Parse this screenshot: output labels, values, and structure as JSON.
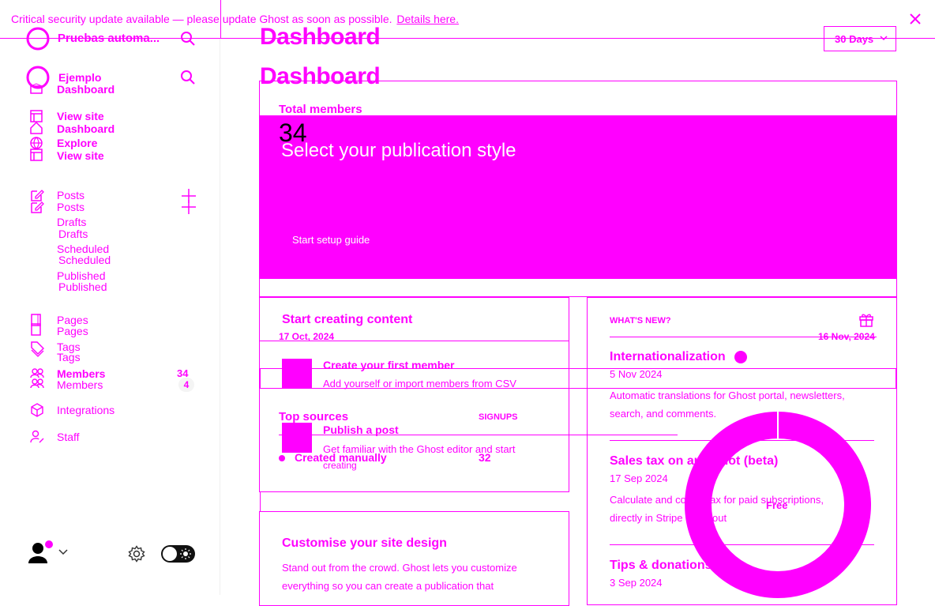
{
  "banner": {
    "message": "Critical security update available — please update Ghost as soon as possible.",
    "link": "Details here."
  },
  "site": {
    "name": "Pruebas automa...",
    "name_ghost": "Ejemplo"
  },
  "sidebar": {
    "dashboard": "Dashboard",
    "view_site": "View site",
    "dashboard_ghost": "Dashboard",
    "explore": "Explore",
    "view_site_ghost": "View site",
    "posts": "Posts",
    "posts_ghost": "Posts",
    "drafts": "Drafts",
    "drafts_ghost": "Drafts",
    "scheduled": "Scheduled",
    "scheduled_ghost": "Scheduled",
    "published": "Published",
    "published_ghost": "Published",
    "pages": "Pages",
    "pages_ghost": "Pages",
    "tags": "Tags",
    "tags_ghost": "Tags",
    "members": "Members",
    "members_count": "34",
    "members_ghost": "Members",
    "members_ghost_count": "4",
    "integrations": "Integrations",
    "staff": "Staff"
  },
  "header": {
    "title": "Dashboard",
    "title_ghost": "Dashboard",
    "range": "30 Days"
  },
  "members_card": {
    "label": "Total members",
    "value": "34"
  },
  "setup_banner": {
    "title": "Select your publication style",
    "button": "Start setup guide"
  },
  "start_creating": {
    "title": "Start creating content",
    "date": "17 Oct, 2024",
    "items": [
      {
        "title": "Create your first member",
        "desc": "Add yourself or import members from CSV"
      },
      {
        "title": "Publish a post",
        "desc": "Get familiar with the Ghost editor and start",
        "desc2": "creating"
      }
    ]
  },
  "top_sources": {
    "title": "Top sources",
    "col": "SIGNUPS",
    "rows": [
      {
        "source": "Created manually",
        "count": "32"
      }
    ]
  },
  "customise": {
    "title": "Customise your site design",
    "line1": "Stand out from the crowd. Ghost lets you customize",
    "line2": "everything so you can create a publication that"
  },
  "whats_new": {
    "label": "WHAT'S NEW?",
    "date": "16 Nov, 2024",
    "entries": [
      {
        "title": "Internationalization",
        "date": "5 Nov 2024",
        "line1": "Automatic translations for Ghost portal, newsletters,",
        "line2": "search, and comments."
      },
      {
        "title": "Sales tax on autopilot (beta)",
        "date": "17 Sep 2024",
        "line1": "Calculate and collect tax for paid subscriptions,",
        "line2": "directly in Stripe checkout"
      },
      {
        "title": "Tips & donations",
        "date": "3 Sep 2024"
      }
    ]
  },
  "chart_data": {
    "type": "pie",
    "categories": [
      "Free"
    ],
    "values": [
      100
    ]
  },
  "colors": {
    "accent": "#ff00ff",
    "bg": "#ffffff"
  }
}
